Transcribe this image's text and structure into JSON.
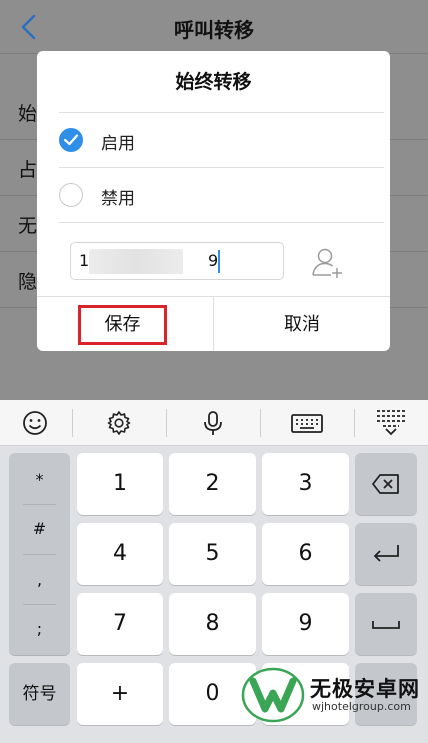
{
  "app": {
    "title": "呼叫转移",
    "rows": [
      "始",
      "占",
      "无",
      "隐"
    ]
  },
  "dialog": {
    "title": "始终转移",
    "options": [
      {
        "label": "启用",
        "checked": true
      },
      {
        "label": "禁用",
        "checked": false
      }
    ],
    "number_prefix": "1",
    "number_suffix": "9",
    "save_label": "保存",
    "cancel_label": "取消"
  },
  "keyboard": {
    "toolbar_icons": [
      "emoji-icon",
      "settings-icon",
      "microphone-icon",
      "keyboard-icon",
      "collapse-keyboard-icon"
    ],
    "symbols": [
      "*",
      "#",
      ",",
      ";"
    ],
    "digits": [
      "1",
      "2",
      "3",
      "4",
      "5",
      "6",
      "7",
      "8",
      "9"
    ],
    "bottom": {
      "symbols_label": "符号",
      "plus": "+",
      "zero": "0"
    }
  },
  "watermark": {
    "name": "无极安卓网",
    "url": "wjhotelgroup.com"
  },
  "colors": {
    "accent": "#2f8fe8",
    "highlight": "#d9242b",
    "watermark_green": "#3aa655"
  }
}
